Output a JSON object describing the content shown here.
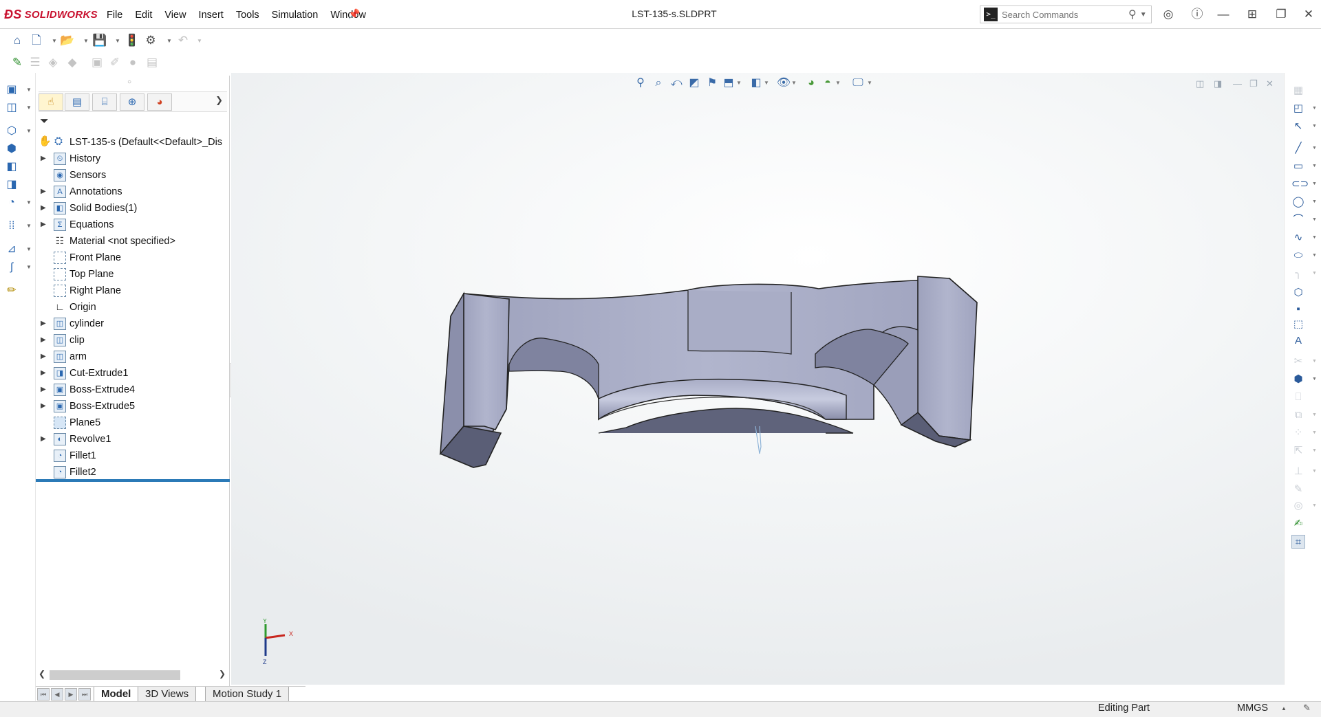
{
  "app": {
    "brand": "SOLIDWORKS",
    "document_title": "LST-135-s.SLDPRT"
  },
  "menu": {
    "items": [
      "File",
      "Edit",
      "View",
      "Insert",
      "Tools",
      "Simulation",
      "Window"
    ]
  },
  "search": {
    "placeholder": "Search Commands"
  },
  "feature_tree": {
    "root": "LST-135-s  (Default<<Default>_Dis",
    "items": [
      {
        "label": "History",
        "icon": "history-folder-icon"
      },
      {
        "label": "Sensors",
        "icon": "sensors-folder-icon"
      },
      {
        "label": "Annotations",
        "icon": "annotations-folder-icon"
      },
      {
        "label": "Solid Bodies(1)",
        "icon": "solid-bodies-folder-icon"
      },
      {
        "label": "Equations",
        "icon": "equations-folder-icon"
      },
      {
        "label": "Material <not specified>",
        "icon": "material-icon"
      },
      {
        "label": "Front Plane",
        "icon": "plane-icon"
      },
      {
        "label": "Top Plane",
        "icon": "plane-icon"
      },
      {
        "label": "Right Plane",
        "icon": "plane-icon"
      },
      {
        "label": "Origin",
        "icon": "origin-icon"
      },
      {
        "label": "cylinder",
        "icon": "feature-icon"
      },
      {
        "label": "clip",
        "icon": "feature-icon"
      },
      {
        "label": "arm",
        "icon": "feature-icon"
      },
      {
        "label": "Cut-Extrude1",
        "icon": "cut-extrude-icon"
      },
      {
        "label": "Boss-Extrude4",
        "icon": "boss-extrude-icon"
      },
      {
        "label": "Boss-Extrude5",
        "icon": "boss-extrude-icon"
      },
      {
        "label": "Plane5",
        "icon": "plane-icon"
      },
      {
        "label": "Revolve1",
        "icon": "revolve-icon"
      },
      {
        "label": "Fillet1",
        "icon": "fillet-icon"
      },
      {
        "label": "Fillet2",
        "icon": "fillet-icon"
      }
    ]
  },
  "triad": {
    "x": "X",
    "y": "Y",
    "z": "Z"
  },
  "bottom_tabs": {
    "model": "Model",
    "views3d": "3D Views",
    "motion": "Motion Study 1"
  },
  "status": {
    "mode": "Editing Part",
    "units": "MMGS"
  },
  "colors": {
    "accent": "#2b7ab7",
    "brand": "#c8102e",
    "model_face": "#a5a9c3"
  }
}
